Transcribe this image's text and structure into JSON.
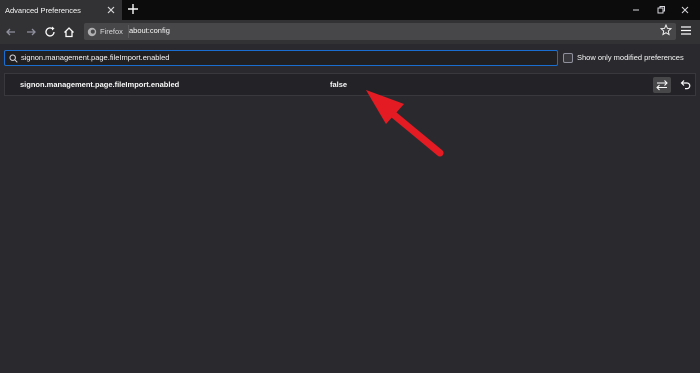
{
  "tab": {
    "title": "Advanced Preferences"
  },
  "urlbar": {
    "identity_label": "Firefox",
    "url": "about:config"
  },
  "search": {
    "value": "signon.management.page.fileImport.enabled"
  },
  "filter": {
    "checkbox_label": "Show only modified preferences",
    "checked": false
  },
  "preference": {
    "name": "signon.management.page.fileImport.enabled",
    "value": "false"
  },
  "colors": {
    "accent": "#1a6ed0",
    "arrow": "#e51b23",
    "background": "#2a2a2e"
  },
  "icons": [
    "close-icon",
    "plus-icon",
    "minimize-icon",
    "restore-icon",
    "back-icon",
    "forward-icon",
    "reload-icon",
    "home-icon",
    "firefox-icon",
    "star-icon",
    "hamburger-menu-icon",
    "search-icon",
    "toggle-icon",
    "undo-icon"
  ]
}
